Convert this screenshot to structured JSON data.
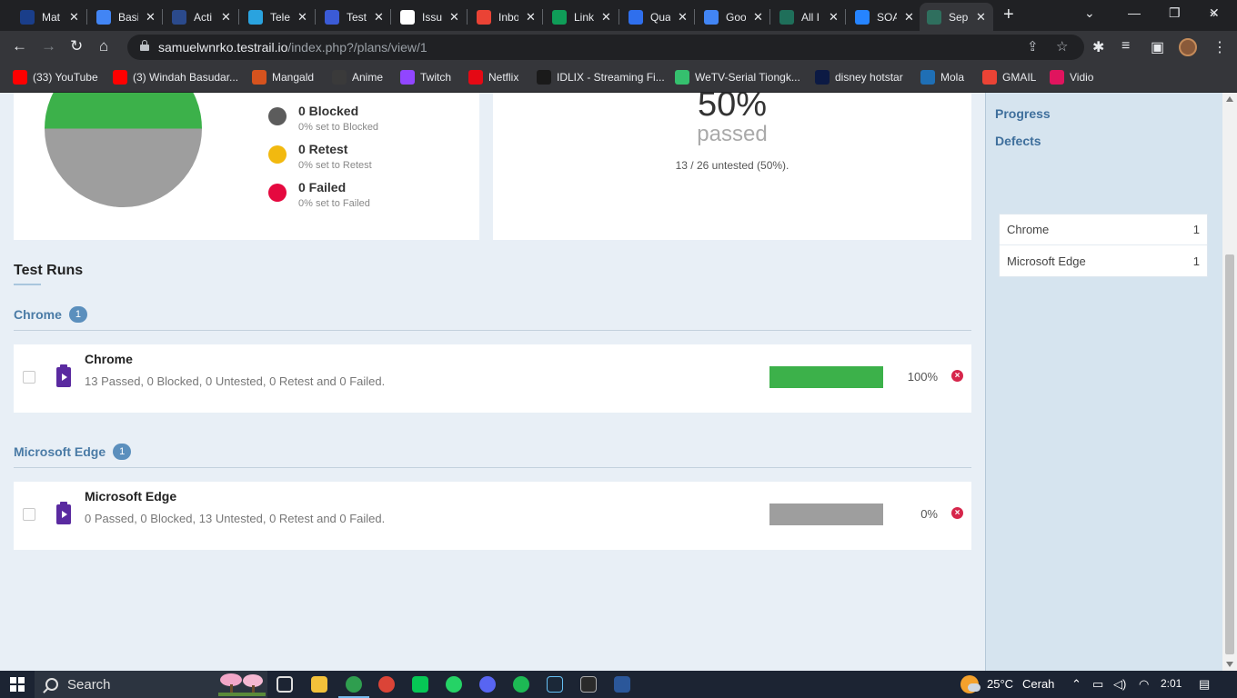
{
  "browser": {
    "tabs": [
      {
        "title": "Mat",
        "color": "#1a3e8a"
      },
      {
        "title": "Basi",
        "color": "#4285f4"
      },
      {
        "title": "Acti",
        "color": "#2b4a8c"
      },
      {
        "title": "Tele",
        "color": "#2aa3df"
      },
      {
        "title": "Test",
        "color": "#3b5bd6"
      },
      {
        "title": "Issu",
        "color": "#ffffff"
      },
      {
        "title": "Inbo",
        "color": "#ea4335"
      },
      {
        "title": "Link",
        "color": "#0f9d58"
      },
      {
        "title": "Qua",
        "color": "#2f6fed"
      },
      {
        "title": "Goo",
        "color": "#4285f4"
      },
      {
        "title": "All I",
        "color": "#1f6f5a"
      },
      {
        "title": "SOA",
        "color": "#2684ff"
      },
      {
        "title": "Sep",
        "color": "#2f6f5e"
      }
    ],
    "url_host": "samuelwnrko.testrail.io",
    "url_path": "/index.php?/plans/view/1",
    "bookmarks": [
      {
        "label": "(33) YouTube",
        "icon": "youtube-icon",
        "color": "#ff0000"
      },
      {
        "label": "(3) Windah Basudar...",
        "icon": "youtube-icon",
        "color": "#ff0000"
      },
      {
        "label": "Mangald",
        "icon": "mangald-icon",
        "color": "#d6531e"
      },
      {
        "label": "Anime",
        "icon": "wordpress-icon",
        "color": "#3a3a3a"
      },
      {
        "label": "Twitch",
        "icon": "twitch-icon",
        "color": "#9146ff"
      },
      {
        "label": "Netflix",
        "icon": "netflix-icon",
        "color": "#e50914"
      },
      {
        "label": "IDLIX - Streaming Fi...",
        "icon": "idlix-icon",
        "color": "#1a1a1a"
      },
      {
        "label": "WeTV-Serial Tiongk...",
        "icon": "wetv-icon",
        "color": "#35c06e"
      },
      {
        "label": "disney hotstar",
        "icon": "hotstar-icon",
        "color": "#0c1a44"
      },
      {
        "label": "Mola",
        "icon": "mola-icon",
        "color": "#1f6fb5"
      },
      {
        "label": "GMAIL",
        "icon": "gmail-icon",
        "color": "#ea4335"
      },
      {
        "label": "Vidio",
        "icon": "vidio-icon",
        "color": "#e0145e"
      }
    ]
  },
  "summary": {
    "legend": [
      {
        "title": "0 Blocked",
        "sub": "0% set to Blocked",
        "color": "#5c5c5c"
      },
      {
        "title": "0 Retest",
        "sub": "0% set to Retest",
        "color": "#f2b90f"
      },
      {
        "title": "0 Failed",
        "sub": "0% set to Failed",
        "color": "#e5093f"
      }
    ],
    "passed_pct_text": "50%",
    "passed_label": "passed",
    "untested_text": "13 / 26 untested (50%).",
    "pie_colors": {
      "passed": "#3cb14a",
      "untested": "#9e9e9e"
    }
  },
  "chart_data": {
    "type": "pie",
    "slices": [
      {
        "label": "Passed",
        "value": 13,
        "color": "#3cb14a"
      },
      {
        "label": "Untested",
        "value": 13,
        "color": "#9e9e9e"
      }
    ]
  },
  "test_runs": {
    "title": "Test Runs",
    "groups": [
      {
        "name": "Chrome",
        "count": "1",
        "run": {
          "name": "Chrome",
          "stats": "13 Passed, 0 Blocked, 0 Untested, 0 Retest and 0 Failed.",
          "pct_text": "100%",
          "passed_fraction": 1.0
        }
      },
      {
        "name": "Microsoft Edge",
        "count": "1",
        "run": {
          "name": "Microsoft Edge",
          "stats": "0 Passed, 0 Blocked, 13 Untested, 0 Retest and 0 Failed.",
          "pct_text": "0%",
          "passed_fraction": 0.0
        }
      }
    ]
  },
  "sidebar": {
    "links": [
      "Progress",
      "Defects"
    ],
    "configs": [
      {
        "label": "Chrome",
        "count": "1"
      },
      {
        "label": "Microsoft Edge",
        "count": "1"
      }
    ]
  },
  "taskbar": {
    "search_placeholder": "Search",
    "temperature": "25°C",
    "weather": "Cerah",
    "time": "2:01"
  }
}
